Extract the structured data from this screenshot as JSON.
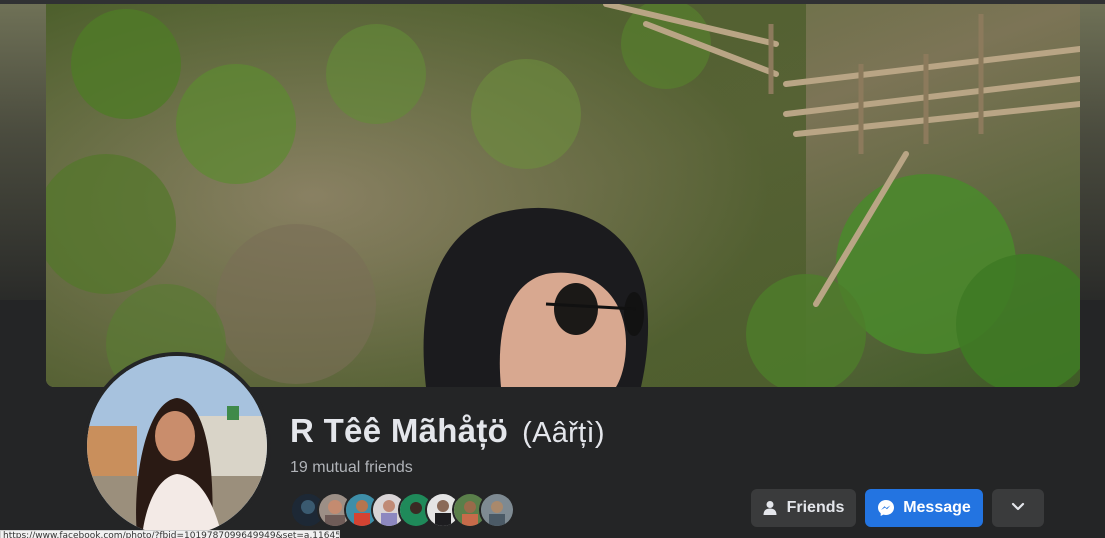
{
  "profile": {
    "name": "R Têê Mãhåțö",
    "alternate_name": "(Aâřțì)",
    "mutual_friends": "19 mutual friends"
  },
  "actions": {
    "friends_label": "Friends",
    "message_label": "Message",
    "more_icon": "chevron-down-icon"
  },
  "icons": {
    "friends": "person-check-icon",
    "message": "messenger-icon"
  },
  "mutual_friend_avatars": 8,
  "status_bar": {
    "url": "https://www.facebook.com/photo/?fbid=1019787099649949&set=a.116451612034"
  },
  "colors": {
    "background": "#242526",
    "primary_button": "#2374e1",
    "secondary_button": "#3a3b3c",
    "text_primary": "#e4e6eb",
    "text_secondary": "#b0b3b8"
  }
}
